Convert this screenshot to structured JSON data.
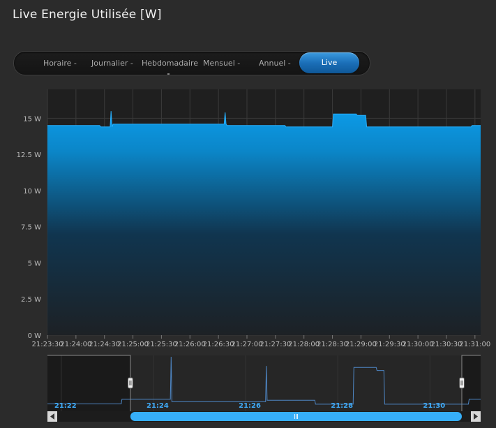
{
  "title": "Live Energie Utilisée [W]",
  "tabs": [
    {
      "label": "Horaire -"
    },
    {
      "label": "Journalier -"
    },
    {
      "label": "Hebdomadaire"
    },
    {
      "label": "Mensuel -"
    },
    {
      "label": "Annuel -"
    },
    {
      "label": "Live",
      "active": true
    }
  ],
  "colors": {
    "accent": "#0d9be8",
    "background": "#2b2b2b",
    "plot_background": "#1f1f1f",
    "navigator_line": "#4e86c4",
    "navigator_label": "#3fa9f5"
  },
  "chart_data": {
    "type": "area",
    "ylim": [
      0,
      17
    ],
    "yticks": [
      0,
      2.5,
      5,
      7.5,
      10,
      12.5,
      15
    ],
    "ytick_labels": [
      "0 W",
      "2.5 W",
      "5 W",
      "7.5 W",
      "10 W",
      "12.5 W",
      "15 W"
    ],
    "xticks": [
      "21:23:30",
      "21:24:00",
      "21:24:30",
      "21:25:00",
      "21:25:30",
      "21:26:00",
      "21:26:30",
      "21:27:00",
      "21:27:30",
      "21:28:00",
      "21:28:30",
      "21:29:00",
      "21:29:30",
      "21:30:00",
      "21:30:30",
      "21:31:00"
    ],
    "xlim_seconds": [
      1410,
      1866
    ],
    "grid": true,
    "series": [
      {
        "x": [
          "21:23:30",
          "21:24:25",
          "21:24:26",
          "21:24:36",
          "21:24:37",
          "21:24:38",
          "21:24:39",
          "21:26:36",
          "21:26:37",
          "21:26:38",
          "21:26:39",
          "21:27:40",
          "21:27:41",
          "21:28:30",
          "21:28:31",
          "21:28:55",
          "21:28:56",
          "21:29:05",
          "21:29:06",
          "21:30:56",
          "21:30:57",
          "21:31:06"
        ],
        "values": [
          14.5,
          14.5,
          14.4,
          14.4,
          15.5,
          14.4,
          14.6,
          14.6,
          15.4,
          14.6,
          14.5,
          14.5,
          14.4,
          14.4,
          15.3,
          15.3,
          15.2,
          15.2,
          14.4,
          14.4,
          14.5,
          14.5
        ]
      }
    ],
    "navigator": {
      "xlim_seconds": [
        1302,
        1866
      ],
      "ylim": [
        0,
        17
      ],
      "range_seconds": [
        1410,
        1866
      ],
      "labels": [
        "21:22",
        "21:24",
        "21:26",
        "21:28",
        "21:30"
      ],
      "x": [
        "21:21:42",
        "21:23:18",
        "21:23:19",
        "21:24:22",
        "21:24:23",
        "21:24:24",
        "21:26:26",
        "21:26:27",
        "21:26:28",
        "21:27:30",
        "21:27:31",
        "21:28:20",
        "21:28:21",
        "21:28:50",
        "21:28:51",
        "21:29:00",
        "21:29:01",
        "21:30:50",
        "21:30:51",
        "21:31:06"
      ],
      "values": [
        1.5,
        1.5,
        3.0,
        3.0,
        17,
        2.2,
        2.2,
        14,
        2.7,
        2.7,
        1.4,
        1.4,
        13.5,
        13.5,
        12.5,
        12.5,
        1.4,
        1.4,
        3.0,
        3.0
      ]
    }
  }
}
